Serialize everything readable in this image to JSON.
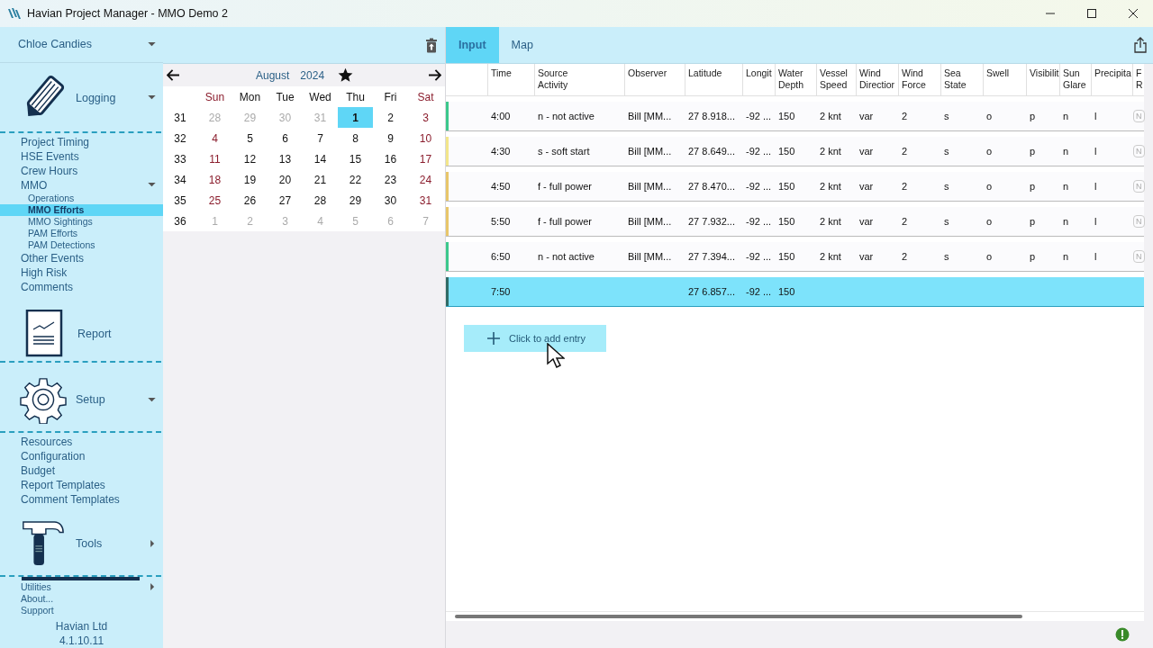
{
  "window": {
    "title": "Havian Project Manager - MMO Demo 2"
  },
  "user": {
    "name": "Chloe Candies"
  },
  "sidebar": {
    "sections": [
      {
        "kind": "logging",
        "label": "Logging",
        "expanded": true,
        "items": [
          {
            "label": "Project Timing",
            "selected": false
          },
          {
            "label": "HSE Events",
            "selected": false
          },
          {
            "label": "Crew Hours",
            "selected": false
          },
          {
            "label": "MMO",
            "selected": false,
            "expanded": true,
            "children": [
              {
                "label": "Operations",
                "selected": false
              },
              {
                "label": "MMO Efforts",
                "selected": true
              },
              {
                "label": "MMO Sightings",
                "selected": false
              },
              {
                "label": "PAM Efforts",
                "selected": false
              },
              {
                "label": "PAM Detections",
                "selected": false
              }
            ]
          },
          {
            "label": "Other Events",
            "selected": false
          },
          {
            "label": "High Risk",
            "selected": false
          },
          {
            "label": "Comments",
            "selected": false
          }
        ]
      },
      {
        "kind": "report",
        "label": "Report"
      },
      {
        "kind": "setup",
        "label": "Setup",
        "expanded": true,
        "items": [
          {
            "label": "Resources",
            "selected": false
          },
          {
            "label": "Configuration",
            "selected": false
          },
          {
            "label": "Budget",
            "selected": false
          },
          {
            "label": "Report Templates",
            "selected": false
          },
          {
            "label": "Comment Templates",
            "selected": false
          }
        ]
      },
      {
        "kind": "tools",
        "label": "Tools",
        "expanded": false
      }
    ],
    "footer_items": [
      {
        "label": "Utilities",
        "submenu": true
      },
      {
        "label": "About...",
        "submenu": false
      },
      {
        "label": "Support",
        "submenu": false
      }
    ],
    "company": "Havian Ltd",
    "version": "4.1.10.11"
  },
  "calendar": {
    "month": "August",
    "year": "2024",
    "weekdays": [
      "Sun",
      "Mon",
      "Tue",
      "Wed",
      "Thu",
      "Fri",
      "Sat"
    ],
    "weeks": [
      {
        "number": "31",
        "days": [
          {
            "label": "28",
            "muted": true,
            "selected": false
          },
          {
            "label": "29",
            "muted": true,
            "selected": false
          },
          {
            "label": "30",
            "muted": true,
            "selected": false
          },
          {
            "label": "31",
            "muted": true,
            "selected": false
          },
          {
            "label": "1",
            "muted": false,
            "selected": true
          },
          {
            "label": "2",
            "muted": false,
            "selected": false
          },
          {
            "label": "3",
            "muted": false,
            "selected": false
          }
        ]
      },
      {
        "number": "32",
        "days": [
          {
            "label": "4",
            "muted": false,
            "selected": false
          },
          {
            "label": "5",
            "muted": false,
            "selected": false
          },
          {
            "label": "6",
            "muted": false,
            "selected": false
          },
          {
            "label": "7",
            "muted": false,
            "selected": false
          },
          {
            "label": "8",
            "muted": false,
            "selected": false
          },
          {
            "label": "9",
            "muted": false,
            "selected": false
          },
          {
            "label": "10",
            "muted": false,
            "selected": false
          }
        ]
      },
      {
        "number": "33",
        "days": [
          {
            "label": "11",
            "muted": false,
            "selected": false
          },
          {
            "label": "12",
            "muted": false,
            "selected": false
          },
          {
            "label": "13",
            "muted": false,
            "selected": false
          },
          {
            "label": "14",
            "muted": false,
            "selected": false
          },
          {
            "label": "15",
            "muted": false,
            "selected": false
          },
          {
            "label": "16",
            "muted": false,
            "selected": false
          },
          {
            "label": "17",
            "muted": false,
            "selected": false
          }
        ]
      },
      {
        "number": "34",
        "days": [
          {
            "label": "18",
            "muted": false,
            "selected": false
          },
          {
            "label": "19",
            "muted": false,
            "selected": false
          },
          {
            "label": "20",
            "muted": false,
            "selected": false
          },
          {
            "label": "21",
            "muted": false,
            "selected": false
          },
          {
            "label": "22",
            "muted": false,
            "selected": false
          },
          {
            "label": "23",
            "muted": false,
            "selected": false
          },
          {
            "label": "24",
            "muted": false,
            "selected": false
          }
        ]
      },
      {
        "number": "35",
        "days": [
          {
            "label": "25",
            "muted": false,
            "selected": false
          },
          {
            "label": "26",
            "muted": false,
            "selected": false
          },
          {
            "label": "27",
            "muted": false,
            "selected": false
          },
          {
            "label": "28",
            "muted": false,
            "selected": false
          },
          {
            "label": "29",
            "muted": false,
            "selected": false
          },
          {
            "label": "30",
            "muted": false,
            "selected": false
          },
          {
            "label": "31",
            "muted": false,
            "selected": false
          }
        ]
      },
      {
        "number": "36",
        "days": [
          {
            "label": "1",
            "muted": true,
            "selected": false
          },
          {
            "label": "2",
            "muted": true,
            "selected": false
          },
          {
            "label": "3",
            "muted": true,
            "selected": false
          },
          {
            "label": "4",
            "muted": true,
            "selected": false
          },
          {
            "label": "5",
            "muted": true,
            "selected": false
          },
          {
            "label": "6",
            "muted": true,
            "selected": false
          },
          {
            "label": "7",
            "muted": true,
            "selected": false
          }
        ]
      }
    ]
  },
  "tabs": [
    {
      "label": "Input",
      "selected": true
    },
    {
      "label": "Map",
      "selected": false
    }
  ],
  "table": {
    "columns": [
      "Time",
      "Source\nActivity",
      "Observer",
      "Latitude",
      "Longit",
      "Water\nDepth",
      "Vessel\nSpeed",
      "Wind\nDirectior",
      "Wind\nForce",
      "Sea\nState",
      "Swell",
      "Visibilit",
      "Sun\nGlare",
      "Precipita",
      "F\nR"
    ],
    "rows": [
      {
        "color": "#3cc88c",
        "selected": false,
        "cells": [
          "4:00",
          "n - not active",
          "Bill [MM...",
          "27 8.918...",
          "-92 ...",
          "150",
          "2 knt",
          "var",
          "2",
          "s",
          "o",
          "p",
          "n",
          "l",
          "N"
        ]
      },
      {
        "color": "#f2e68a",
        "selected": false,
        "cells": [
          "4:30",
          "s - soft start",
          "Bill [MM...",
          "27 8.649...",
          "-92 ...",
          "150",
          "2 knt",
          "var",
          "2",
          "s",
          "o",
          "p",
          "n",
          "l",
          "N"
        ]
      },
      {
        "color": "#e8c66a",
        "selected": false,
        "cells": [
          "4:50",
          "f - full power",
          "Bill [MM...",
          "27 8.470...",
          "-92 ...",
          "150",
          "2 knt",
          "var",
          "2",
          "s",
          "o",
          "p",
          "n",
          "l",
          "N"
        ]
      },
      {
        "color": "#e8c66a",
        "selected": false,
        "cells": [
          "5:50",
          "f - full power",
          "Bill [MM...",
          "27 7.932...",
          "-92 ...",
          "150",
          "2 knt",
          "var",
          "2",
          "s",
          "o",
          "p",
          "n",
          "l",
          "N"
        ]
      },
      {
        "color": "#3cc88c",
        "selected": false,
        "cells": [
          "6:50",
          "n - not active",
          "Bill [MM...",
          "27 7.394...",
          "-92 ...",
          "150",
          "2 knt",
          "var",
          "2",
          "s",
          "o",
          "p",
          "n",
          "l",
          "N"
        ]
      },
      {
        "color": "#2f6b66",
        "selected": true,
        "cells": [
          "7:50",
          null,
          null,
          "27 6.857...",
          "-92 ...",
          "150",
          null,
          null,
          null,
          null,
          null,
          null,
          null,
          null,
          null
        ]
      }
    ]
  },
  "add_button": {
    "label": "Click to add entry"
  }
}
